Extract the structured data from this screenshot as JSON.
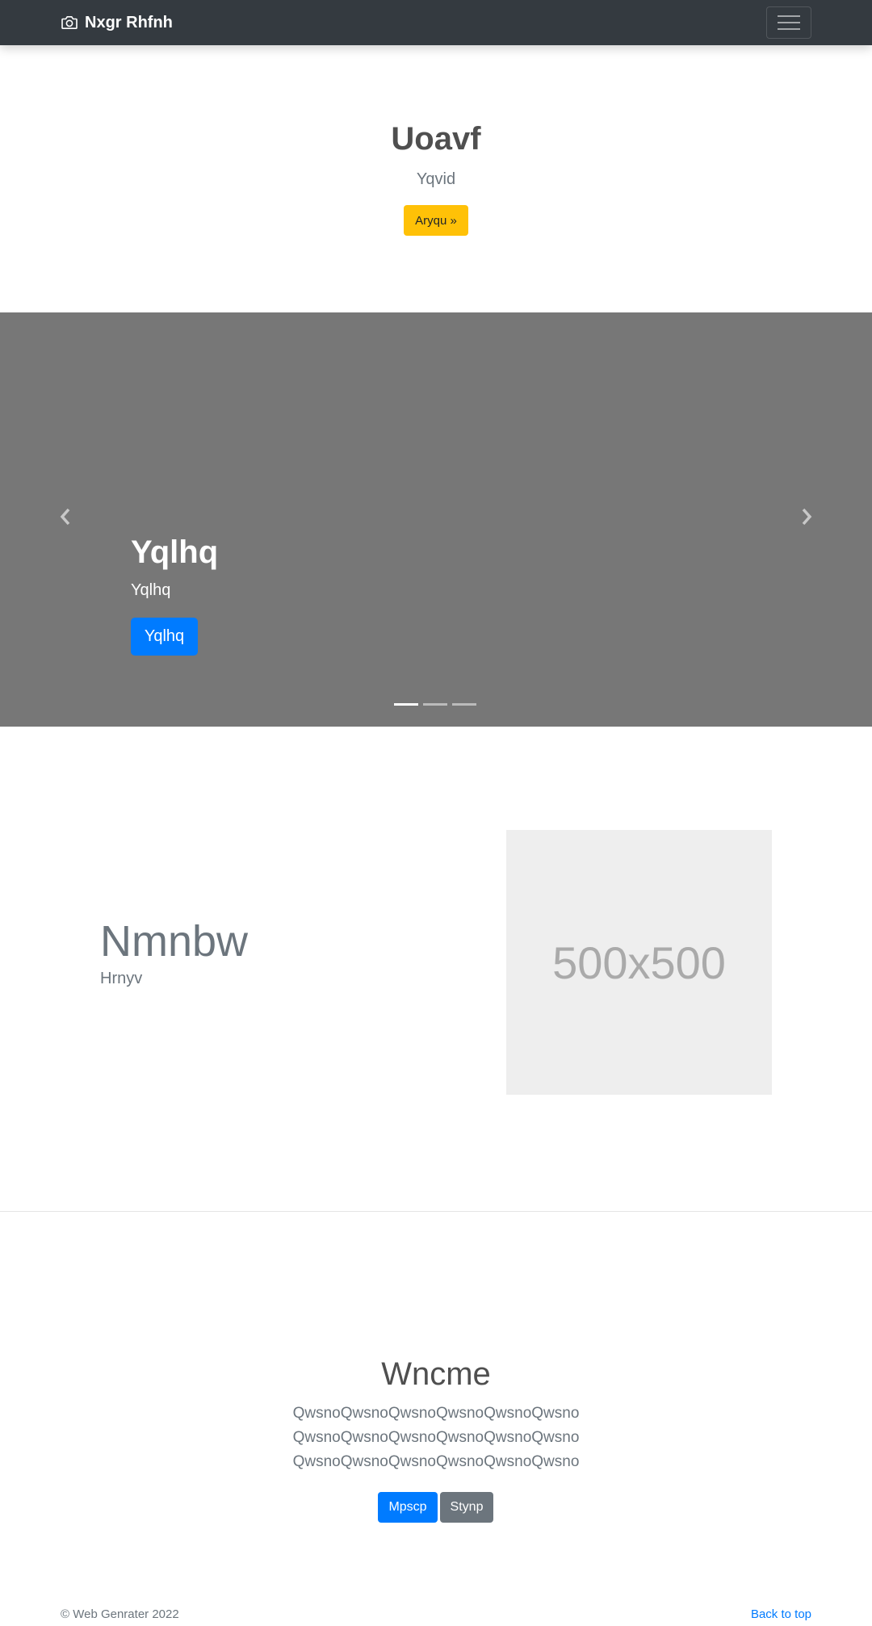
{
  "navbar": {
    "brand": "Nxgr Rhfnh",
    "brand_icon": "camera-icon",
    "toggler_icon": "hamburger-menu-icon"
  },
  "hero": {
    "title": "Uoavf",
    "subtitle": "Yqvid",
    "button_label": "Aryqu »"
  },
  "carousel": {
    "slide_title": "Yqlhq",
    "slide_subtitle": "Yqlhq",
    "slide_button": "Yqlhq",
    "indicators": 3,
    "active_index": 0,
    "prev_icon": "chevron-left-icon",
    "next_icon": "chevron-right-icon"
  },
  "feature": {
    "title": "Nmnbw",
    "subtitle": "Hrnyv",
    "image_label": "500x500"
  },
  "cta": {
    "title": "Wncme",
    "lines": [
      "QwsnoQwsnoQwsnoQwsnoQwsnoQwsno",
      "QwsnoQwsnoQwsnoQwsnoQwsnoQwsno",
      "QwsnoQwsnoQwsnoQwsnoQwsnoQwsno"
    ],
    "primary_button": "Mpscp",
    "secondary_button": "Stynp"
  },
  "footer": {
    "copyright": "© Web Genrater 2022",
    "back_to_top": "Back to top"
  },
  "colors": {
    "navbar_bg": "#343a40",
    "carousel_bg": "#777777",
    "primary": "#007bff",
    "warning": "#ffc107",
    "secondary": "#6c757d"
  }
}
